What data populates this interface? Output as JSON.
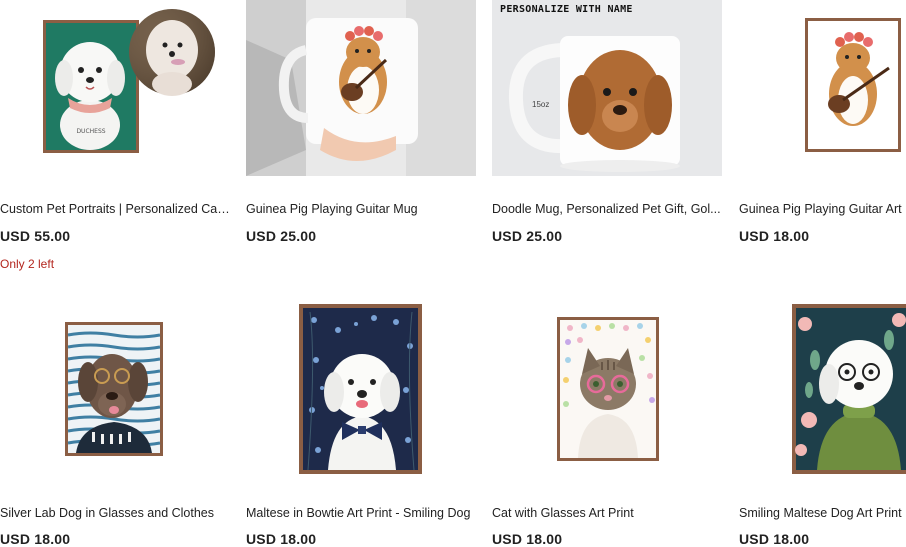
{
  "listings": [
    {
      "title": "Custom Pet Portraits | Personalized Cat ...",
      "price": "USD 55.00",
      "stock": "Only 2 left",
      "name_on_art": "DUCHESS"
    },
    {
      "title": "Guinea Pig Playing Guitar Mug",
      "price": "USD 25.00"
    },
    {
      "title": "Doodle Mug, Personalized Pet Gift, Gol...",
      "price": "USD 25.00",
      "banner": "PERSONALIZE WITH NAME",
      "mug_size": "15oz"
    },
    {
      "title": "Guinea Pig Playing Guitar Art P",
      "price": "USD 18.00"
    },
    {
      "title": "Silver Lab Dog in Glasses and Clothes",
      "price": "USD 18.00"
    },
    {
      "title": "Maltese in Bowtie Art Print - Smiling Dog",
      "price": "USD 18.00"
    },
    {
      "title": "Cat with Glasses Art Print",
      "price": "USD 18.00"
    },
    {
      "title": "Smiling Maltese Dog Art Print",
      "price": "USD 18.00"
    }
  ],
  "colors": {
    "frame": "#8b5e44",
    "stock_warning": "#b3261e"
  }
}
